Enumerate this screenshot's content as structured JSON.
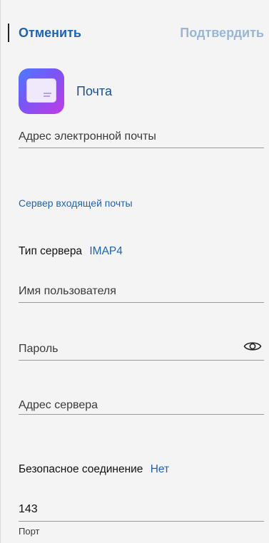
{
  "header": {
    "cancel_label": "Отменить",
    "confirm_label": "Подтвердить"
  },
  "app": {
    "name": "Почта",
    "icon": "mail-envelope-icon"
  },
  "fields": {
    "email_label": "Адрес электронной почты",
    "incoming_section": "Сервер входящей почты",
    "server_type_label": "Тип сервера",
    "server_type_value": "IMAP4",
    "username_label": "Имя пользователя",
    "password_label": "Пароль",
    "server_address_label": "Адрес сервера",
    "secure_connection_label": "Безопасное соединение",
    "secure_connection_value": "Нет",
    "port_value": "143",
    "port_label": "Порт"
  },
  "colors": {
    "accent": "#1e63b4",
    "disabled_accent": "#9ab6d6",
    "background": "#f4f4f4"
  }
}
